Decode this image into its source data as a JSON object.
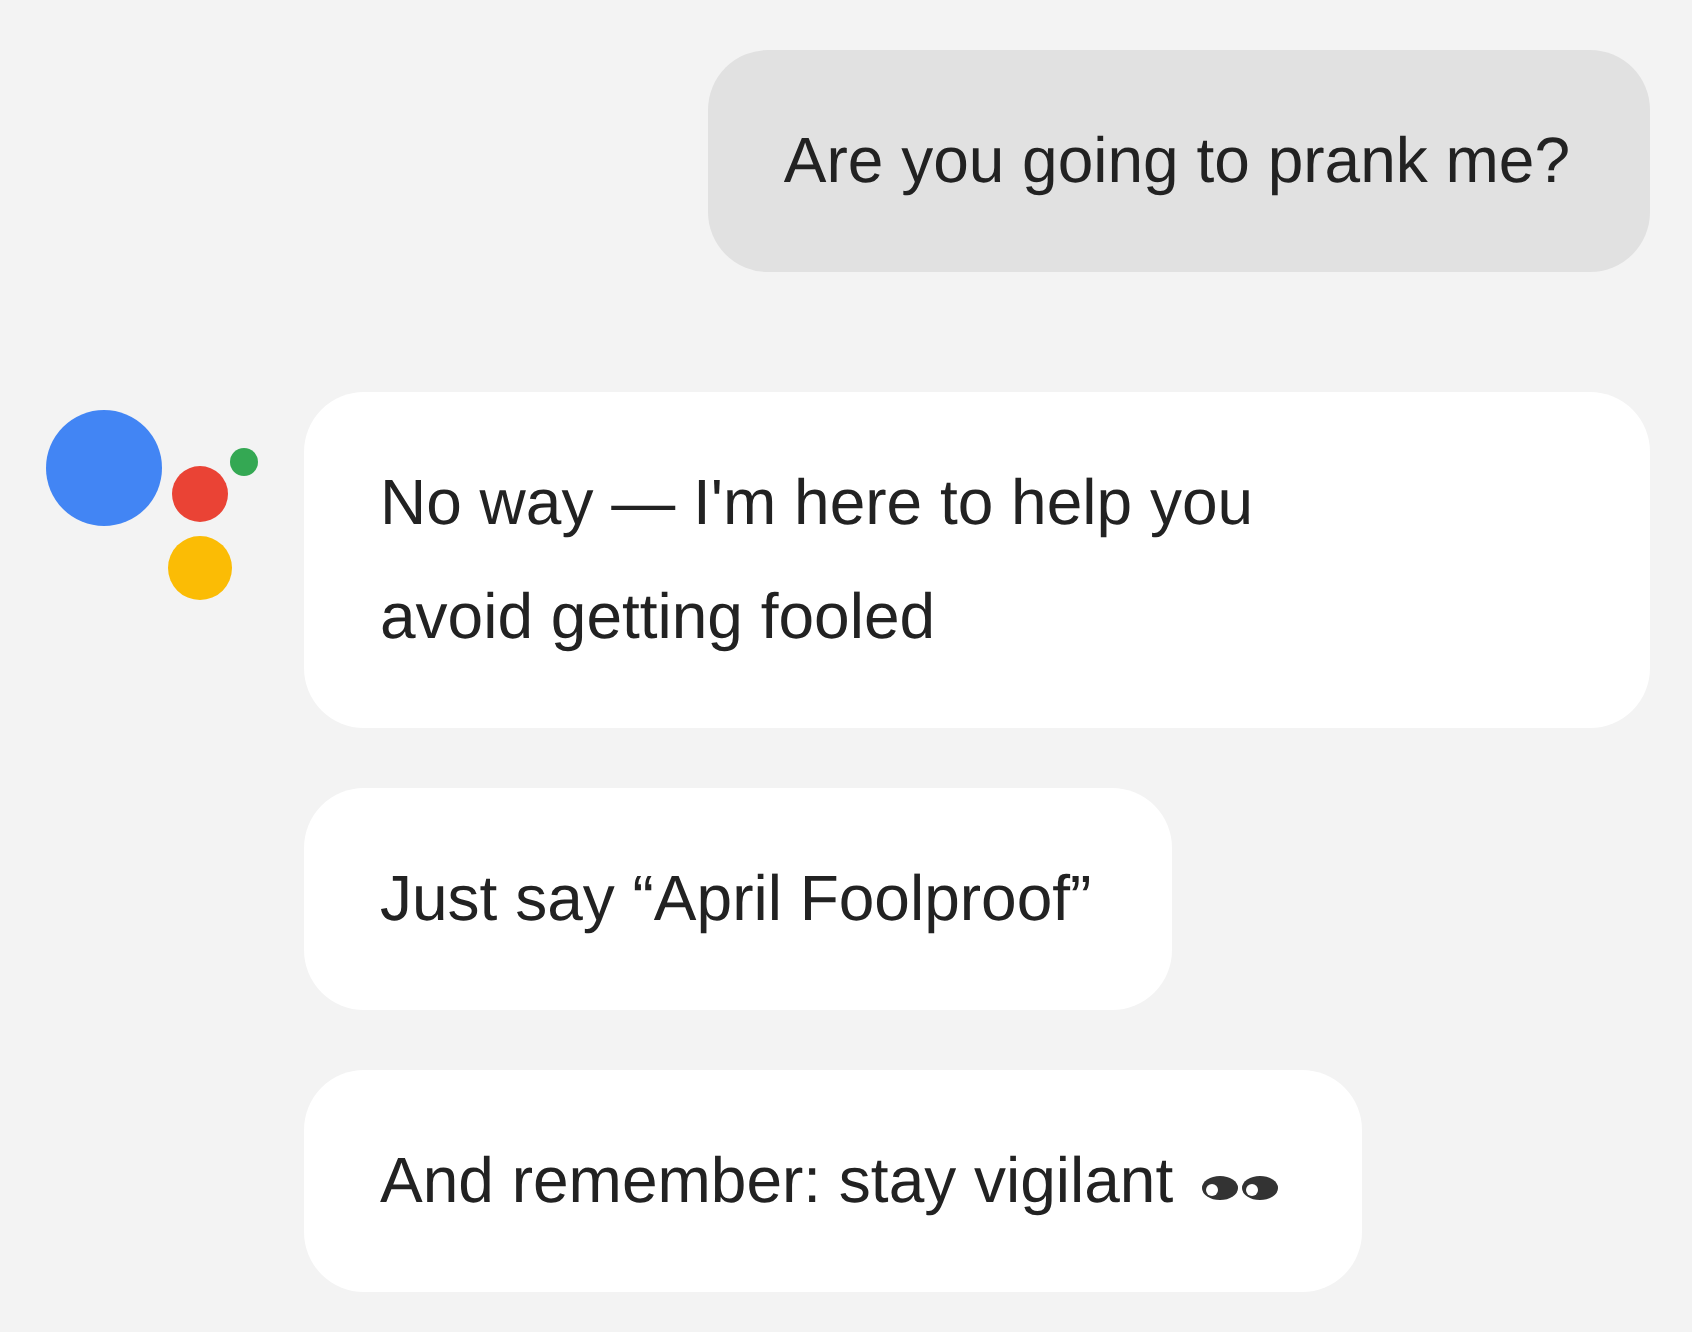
{
  "messages": [
    {
      "kind": "user",
      "text": "Are you going to prank me?"
    },
    {
      "kind": "assistant",
      "text": "No way — I'm here to help you avoid getting fooled",
      "avatar": true
    },
    {
      "kind": "assistant",
      "text": "Just say “April Foolproof”"
    },
    {
      "kind": "assistant",
      "text": "And remember: stay vigilant",
      "eyes": true
    }
  ]
}
